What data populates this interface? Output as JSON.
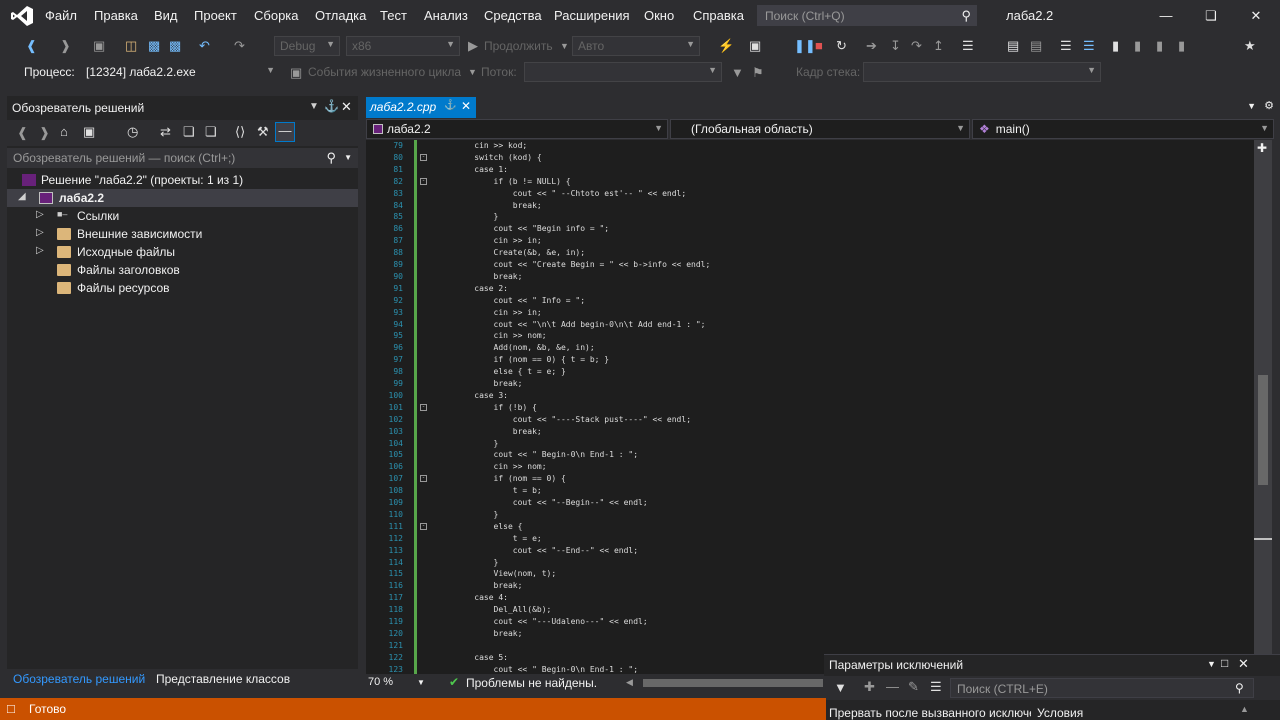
{
  "menu": {
    "items": [
      "Файл",
      "Правка",
      "Вид",
      "Проект",
      "Сборка",
      "Отладка",
      "Тест",
      "Анализ",
      "Средства",
      "Расширения",
      "Окно",
      "Справка"
    ],
    "search_placeholder": "Поиск (Ctrl+Q)",
    "solution_name": "лаба2.2"
  },
  "toolbar": {
    "config": "Debug",
    "platform": "x86",
    "continue_label": "Продолжить",
    "auto_label": "Авто",
    "process_label": "Процесс:",
    "process_value": "[12324] лаба2.2.exe",
    "lifecycle_label": "События жизненного цикла",
    "thread_label": "Поток:",
    "stack_label": "Кадр стека:"
  },
  "solution_explorer": {
    "title": "Обозреватель решений",
    "search_placeholder": "Обозреватель решений — поиск (Ctrl+;)",
    "tree": [
      {
        "label": "Решение \"лаба2.2\" (проекты: 1 из 1)"
      },
      {
        "label": "лаба2.2"
      },
      {
        "label": "Ссылки"
      },
      {
        "label": "Внешние зависимости"
      },
      {
        "label": "Исходные файлы"
      },
      {
        "label": "Файлы заголовков"
      },
      {
        "label": "Файлы ресурсов"
      }
    ],
    "tabs": [
      "Обозреватель решений",
      "Представление классов"
    ]
  },
  "editor": {
    "file_tab": "лаба2.2.cpp",
    "nav_project": "лаба2.2",
    "nav_scope": "(Глобальная область)",
    "nav_member": "main()",
    "zoom": "70 %",
    "issues": "Проблемы не найдены.",
    "lines": [
      {
        "n": "79",
        "code": "    cin >> kod;"
      },
      {
        "n": "80",
        "code": "    switch (kod) {"
      },
      {
        "n": "81",
        "code": "    case 1:"
      },
      {
        "n": "82",
        "code": "        if (b != NULL) {"
      },
      {
        "n": "83",
        "code": "            cout << \" --Chtoto est'-- \" << endl;"
      },
      {
        "n": "84",
        "code": "            break;"
      },
      {
        "n": "85",
        "code": "        }"
      },
      {
        "n": "86",
        "code": "        cout << \"Begin info = \";"
      },
      {
        "n": "87",
        "code": "        cin >> in;"
      },
      {
        "n": "88",
        "code": "        Create(&b, &e, in);"
      },
      {
        "n": "89",
        "code": "        cout << \"Create Begin = \" << b->info << endl;"
      },
      {
        "n": "90",
        "code": "        break;"
      },
      {
        "n": "91",
        "code": "    case 2:"
      },
      {
        "n": "92",
        "code": "        cout << \" Info = \";"
      },
      {
        "n": "93",
        "code": "        cin >> in;"
      },
      {
        "n": "94",
        "code": "        cout << \"\\n\\t Add begin-0\\n\\t Add end-1 : \";"
      },
      {
        "n": "95",
        "code": "        cin >> nom;"
      },
      {
        "n": "96",
        "code": "        Add(nom, &b, &e, in);"
      },
      {
        "n": "97",
        "code": "        if (nom == 0) { t = b; }"
      },
      {
        "n": "98",
        "code": "        else { t = e; }"
      },
      {
        "n": "99",
        "code": "        break;"
      },
      {
        "n": "100",
        "code": "    case 3:"
      },
      {
        "n": "101",
        "code": "        if (!b) {"
      },
      {
        "n": "102",
        "code": "            cout << \"----Stack pust----\" << endl;"
      },
      {
        "n": "103",
        "code": "            break;"
      },
      {
        "n": "104",
        "code": "        }"
      },
      {
        "n": "105",
        "code": "        cout << \" Begin-0\\n End-1 : \";"
      },
      {
        "n": "106",
        "code": "        cin >> nom;"
      },
      {
        "n": "107",
        "code": "        if (nom == 0) {"
      },
      {
        "n": "108",
        "code": "            t = b;"
      },
      {
        "n": "109",
        "code": "            cout << \"--Begin--\" << endl;"
      },
      {
        "n": "110",
        "code": "        }"
      },
      {
        "n": "111",
        "code": "        else {"
      },
      {
        "n": "112",
        "code": "            t = e;"
      },
      {
        "n": "113",
        "code": "            cout << \"--End--\" << endl;"
      },
      {
        "n": "114",
        "code": "        }"
      },
      {
        "n": "115",
        "code": "        View(nom, t);"
      },
      {
        "n": "116",
        "code": "        break;"
      },
      {
        "n": "117",
        "code": "    case 4:"
      },
      {
        "n": "118",
        "code": "        Del_All(&b);"
      },
      {
        "n": "119",
        "code": "        cout << \"---Udaleno---\" << endl;"
      },
      {
        "n": "120",
        "code": "        break;"
      },
      {
        "n": "121",
        "code": ""
      },
      {
        "n": "122",
        "code": "    case 5:"
      },
      {
        "n": "123",
        "code": "        cout << \" Begin-0\\n End-1 : \";"
      }
    ]
  },
  "exception_settings": {
    "title": "Параметры исключений",
    "search_placeholder": "Поиск (CTRL+E)",
    "col1": "Прервать после вызванного исключения",
    "col2": "Условия"
  },
  "status": {
    "text": "Готово"
  },
  "colors": {
    "accent": "#007acc",
    "status_bar": "#ca5100",
    "background": "#2d2d30",
    "editor_bg": "#1e1e1e"
  }
}
